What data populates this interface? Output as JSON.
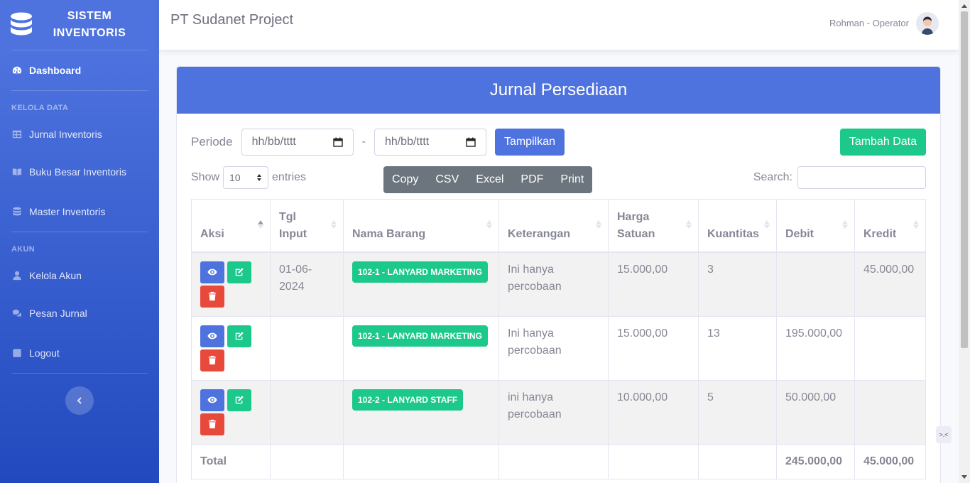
{
  "sidebar": {
    "brand_line1": "SISTEM",
    "brand_line2": "INVENTORIS",
    "dashboard": "Dashboard",
    "section_kelola": "KELOLA DATA",
    "jurnal": "Jurnal Inventoris",
    "buku_besar": "Buku Besar Inventoris",
    "master": "Master Inventoris",
    "section_akun": "AKUN",
    "kelola_akun": "Kelola Akun",
    "pesan_jurnal": "Pesan Jurnal",
    "logout": "Logout"
  },
  "topbar": {
    "company": "PT Sudanet Project",
    "user": "Rohman - Operator"
  },
  "card": {
    "title": "Jurnal Persediaan",
    "periode_label": "Periode",
    "date_from_placeholder": "hh/bb/tttt",
    "date_to_placeholder": "hh/bb/tttt",
    "separator": "-",
    "show_button": "Tampilkan",
    "add_button": "Tambah Data",
    "show_label": "Show",
    "entries_value": "10",
    "entries_label": "entries",
    "search_label": "Search:",
    "export": [
      "Copy",
      "CSV",
      "Excel",
      "PDF",
      "Print"
    ]
  },
  "table": {
    "headers": {
      "aksi": "Aksi",
      "tgl_1": "Tgl",
      "tgl_2": "Input",
      "nama": "Nama Barang",
      "ket": "Keterangan",
      "harga_1": "Harga",
      "harga_2": "Satuan",
      "kuantitas": "Kuantitas",
      "debit": "Debit",
      "kredit": "Kredit"
    },
    "rows": [
      {
        "tgl": "01-06-2024",
        "nama": "102-1 - LANYARD MARKETING",
        "ket": "Ini hanya percobaan",
        "harga": "15.000,00",
        "qty": "3",
        "debit": "",
        "kredit": "45.000,00"
      },
      {
        "tgl": "",
        "nama": "102-1 - LANYARD MARKETING",
        "ket": "Ini hanya percobaan",
        "harga": "15.000,00",
        "qty": "13",
        "debit": "195.000,00",
        "kredit": ""
      },
      {
        "tgl": "",
        "nama": "102-2 - LANYARD STAFF",
        "ket": "ini hanya percobaan",
        "harga": "10.000,00",
        "qty": "5",
        "debit": "50.000,00",
        "kredit": ""
      }
    ],
    "footer": {
      "label": "Total",
      "debit": "245.000,00",
      "kredit": "45.000,00"
    }
  },
  "colors": {
    "primary": "#4e73df",
    "success": "#1cc88a",
    "danger": "#e74a3b",
    "secondary": "#6c757d"
  }
}
